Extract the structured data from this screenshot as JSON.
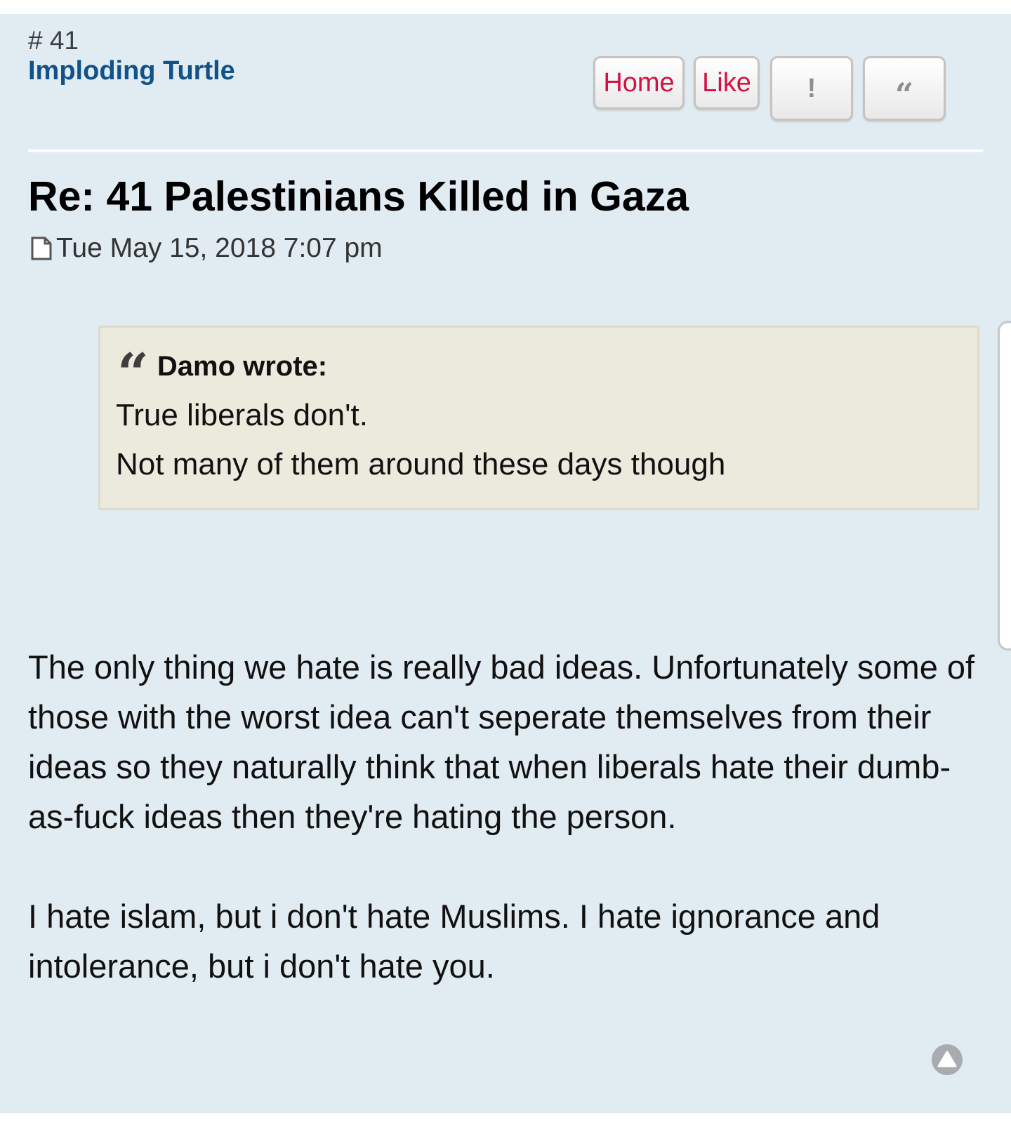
{
  "post": {
    "number": "# 41",
    "author": "Imploding Turtle",
    "title": "Re: 41 Palestinians Killed in Gaza",
    "timestamp": "Tue May 15, 2018 7:07 pm",
    "actions": {
      "home_label": "Home",
      "like_label": "Like",
      "report_label": "!",
      "quote_label": "“"
    },
    "quote": {
      "header": "Damo wrote:",
      "mark": "“",
      "lines": [
        "True liberals don't.",
        "Not many of them around these days though"
      ]
    },
    "body": [
      "The only thing we hate is really bad ideas. Unfortunately some of those with the worst idea can't seperate themselves from their ideas so they naturally think that when liberals hate their dumb-as-fuck ideas then they're hating the person.",
      "I hate islam, but i don't hate Muslims. I hate ignorance and intolerance, but i don't hate you."
    ]
  },
  "colors": {
    "post_background": "#e1ebf2",
    "author": "#105289",
    "button_text": "#d31141",
    "quote_background": "#ebeadd"
  },
  "icons": {
    "post": "file-icon",
    "back_to_top": "arrow-up-icon"
  }
}
